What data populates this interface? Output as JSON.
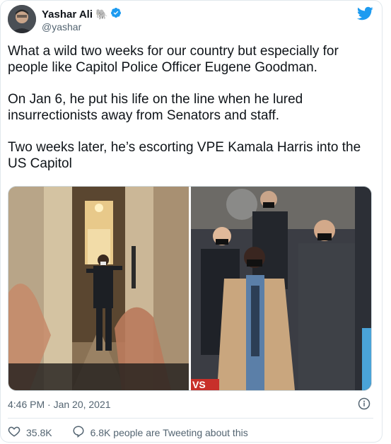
{
  "author": {
    "name": "Yashar Ali",
    "handle": "@yashar",
    "emoji": "🐘",
    "avatar_icon": "avatar-photo"
  },
  "tweet": {
    "paragraphs": [
      "What a wild two weeks for our country but especially for people like Capitol Police Officer Eugene Goodman.",
      "On Jan 6, he put his life on the line when he lured insurrectionists away from Senators and staff.",
      "Two weeks later, he’s escorting VPE Kamala Harris into the US Capitol"
    ],
    "timestamp": "4:46 PM · Jan 20, 2021"
  },
  "media": {
    "left_photo": "capitol-hallway-officer",
    "right_photo": "escort-procession",
    "overlay_text": "VS"
  },
  "actions": {
    "likes": "35.8K",
    "talking": "6.8K people are Tweeting about this"
  },
  "colors": {
    "brand_blue": "#1d9bf0",
    "text": "#0f1419",
    "muted": "#536471"
  }
}
